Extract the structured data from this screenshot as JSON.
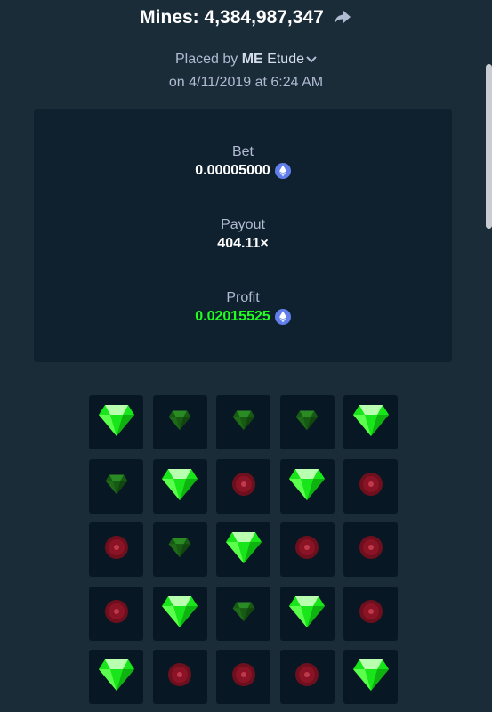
{
  "header": {
    "title": "Mines: 4,384,987,347",
    "placed_prefix": "Placed by",
    "user_badge": "ME",
    "user_name": "Etude",
    "date_text": "on 4/11/2019 at 6:24 AM"
  },
  "stats": {
    "bet_label": "Bet",
    "bet_value": "0.00005000",
    "payout_label": "Payout",
    "payout_value": "404.11×",
    "profit_label": "Profit",
    "profit_value": "0.02015525"
  },
  "colors": {
    "background": "#1a2c38",
    "card": "#0f212e",
    "tile": "#071824",
    "profit_green": "#1fff20",
    "eth_blue": "#627eea"
  },
  "board": {
    "tile_legend": {
      "G": "gem-revealed",
      "g": "gem-unrevealed",
      "M": "mine-unrevealed"
    },
    "rows": [
      [
        "G",
        "g",
        "g",
        "g",
        "G"
      ],
      [
        "g",
        "G",
        "M",
        "G",
        "M"
      ],
      [
        "M",
        "g",
        "G",
        "M",
        "M"
      ],
      [
        "M",
        "G",
        "g",
        "G",
        "M"
      ],
      [
        "G",
        "M",
        "M",
        "M",
        "G"
      ]
    ]
  }
}
